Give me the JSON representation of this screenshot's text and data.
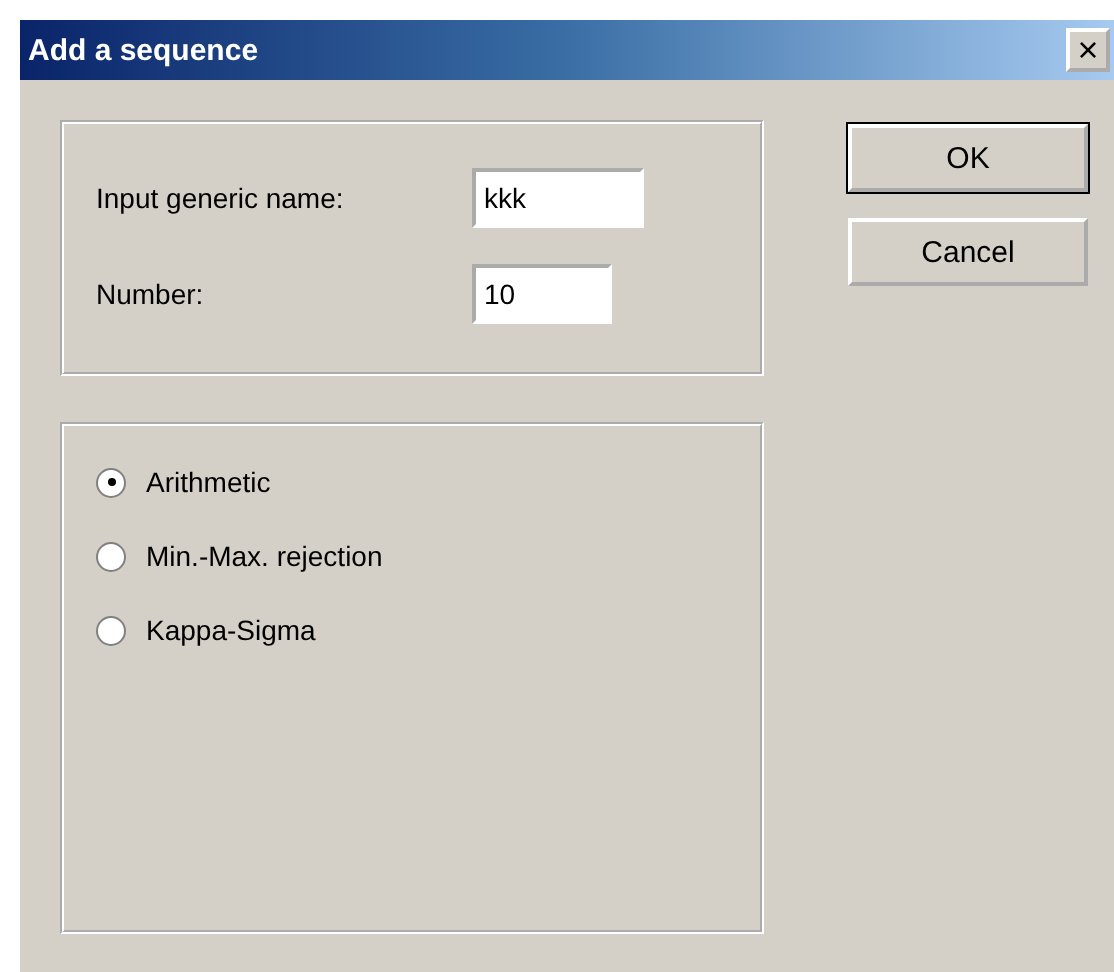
{
  "window": {
    "title": "Add a sequence",
    "close": "×"
  },
  "fields": [
    {
      "label": "Input generic name:",
      "value": "kkk",
      "kind": "wide"
    },
    {
      "label": "Number:",
      "value": "10",
      "kind": "narrow"
    }
  ],
  "methods": [
    {
      "label": "Arithmetic",
      "selected": true
    },
    {
      "label": "Min.-Max. rejection",
      "selected": false
    },
    {
      "label": "Kappa-Sigma",
      "selected": false
    }
  ],
  "buttons": [
    {
      "label": "OK",
      "default": true
    },
    {
      "label": "Cancel",
      "default": false
    }
  ]
}
